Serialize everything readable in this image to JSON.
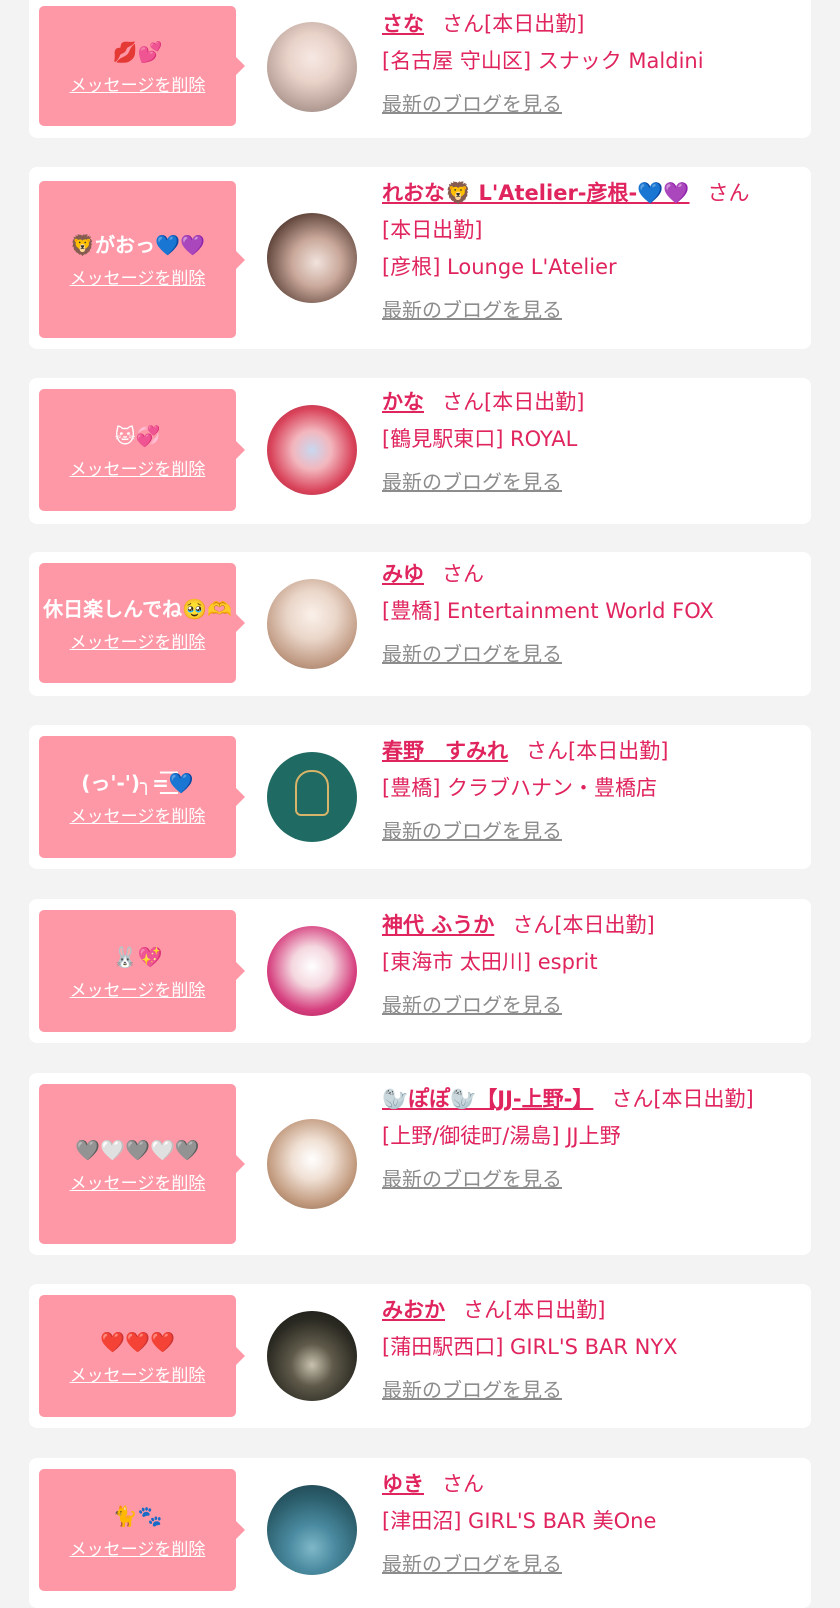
{
  "delete_label": "メッセージを削除",
  "san_label": "さん",
  "blog_label": "最新のブログを見る",
  "colors": {
    "bubble": "#fe98a6",
    "accent": "#e0245e",
    "muted": "#8c8c8c",
    "card": "#ffffff",
    "bg": "#f3f3f3"
  },
  "items": [
    {
      "message": "💋💕",
      "name": "さな",
      "status": "[本日出勤]",
      "shop": "[名古屋 守山区] スナック Maldini"
    },
    {
      "message": "🦁がおっ💙💜",
      "name": "れおな🦁 L'Atelier-彦根-💙💜",
      "status": "[本日出勤]",
      "shop": "[彦根] Lounge L'Atelier"
    },
    {
      "message": "🐱💞",
      "name": "かな",
      "status": "[本日出勤]",
      "shop": "[鶴見駅東口] ROYAL"
    },
    {
      "message": "休日楽しんでね🥹🫶",
      "name": "みゆ",
      "status": "",
      "shop": "[豊橋] Entertainment World FOX"
    },
    {
      "message": "(っ'-')╮=͟͟͞͞💙",
      "name": "春野　すみれ",
      "status": "[本日出勤]",
      "shop": "[豊橋] クラブハナン・豊橋店"
    },
    {
      "message": "🐰💖",
      "name": "神代 ふうか",
      "status": "[本日出勤]",
      "shop": "[東海市 太田川] esprit"
    },
    {
      "message": "🩶🤍🩶🤍🩶",
      "name": "🦭ぽぽ🦭【JJ-上野-】",
      "status": "[本日出勤]",
      "shop": "[上野/御徒町/湯島] JJ上野"
    },
    {
      "message": "❤️❤️❤️",
      "name": "みおか",
      "status": "[本日出勤]",
      "shop": "[蒲田駅西口] GIRL'S BAR NYX"
    },
    {
      "message": "🐈🐾",
      "name": "ゆき",
      "status": "",
      "shop": "[津田沼] GIRL'S BAR 美One"
    }
  ]
}
